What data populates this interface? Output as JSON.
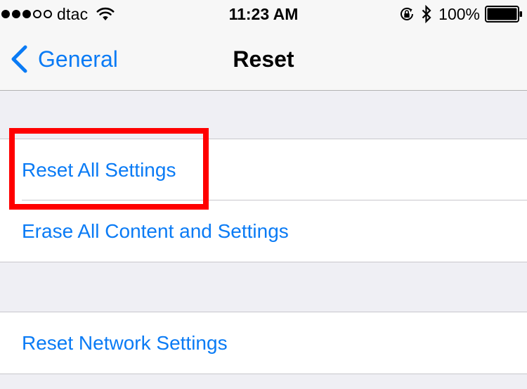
{
  "status_bar": {
    "signal_strength": 3,
    "signal_max": 5,
    "carrier": "dtac",
    "time": "11:23 AM",
    "battery_percent": "100%",
    "battery_level": 1.0,
    "icons": [
      "signal-dots-icon",
      "wifi-icon",
      "rotation-lock-icon",
      "bluetooth-icon",
      "battery-icon"
    ]
  },
  "nav_bar": {
    "back_label": "General",
    "title": "Reset"
  },
  "groups": [
    {
      "items": [
        {
          "label": "Reset All Settings"
        },
        {
          "label": "Erase All Content and Settings"
        }
      ]
    },
    {
      "items": [
        {
          "label": "Reset Network Settings"
        }
      ]
    }
  ],
  "colors": {
    "accent": "#0a7bf5",
    "background": "#efeff4",
    "highlight": "#ff0000"
  }
}
